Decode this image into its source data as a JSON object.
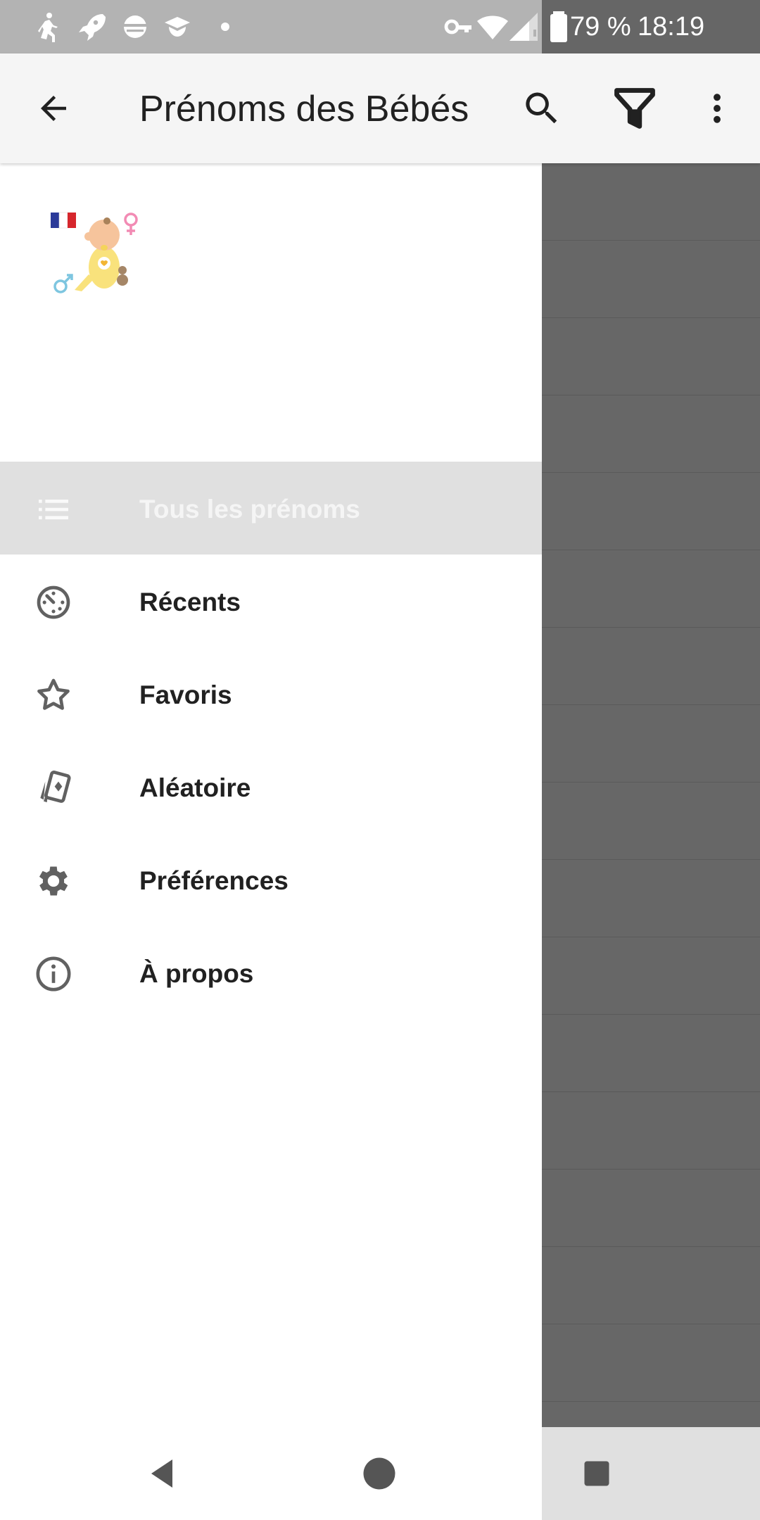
{
  "status_bar": {
    "battery_percent": "79 %",
    "time": "18:19",
    "left_icons": [
      "walking-icon",
      "rocket-icon",
      "planet-icon",
      "cloud-hat-icon",
      "dot-icon"
    ],
    "right_icons": [
      "vpn-key-icon",
      "wifi-icon",
      "signal-icon",
      "battery-icon"
    ]
  },
  "app_bar": {
    "title": "Prénoms des Bébés",
    "icons": [
      "back-arrow-icon",
      "search-icon",
      "filter-icon",
      "more-vert-icon"
    ]
  },
  "drawer": {
    "logo_icon": "baby-logo-icon",
    "items": [
      {
        "label": "Tous les prénoms",
        "icon": "list-icon",
        "active": true
      },
      {
        "label": "Récents",
        "icon": "history-icon",
        "active": false
      },
      {
        "label": "Favoris",
        "icon": "star-icon",
        "active": false
      },
      {
        "label": "Aléatoire",
        "icon": "cards-icon",
        "active": false
      },
      {
        "label": "Préférences",
        "icon": "gear-icon",
        "active": false
      },
      {
        "label": "À propos",
        "icon": "info-icon",
        "active": false
      }
    ]
  },
  "nav_bar": {
    "icons": [
      "nav-back-icon",
      "nav-home-icon",
      "nav-recents-icon"
    ]
  },
  "colors": {
    "status_bar": "#b3b3b3",
    "app_bar": "#f5f5f5",
    "scrim": "#676767",
    "active_item": "#e0e0e0",
    "text": "#212121",
    "icon": "#616161"
  }
}
